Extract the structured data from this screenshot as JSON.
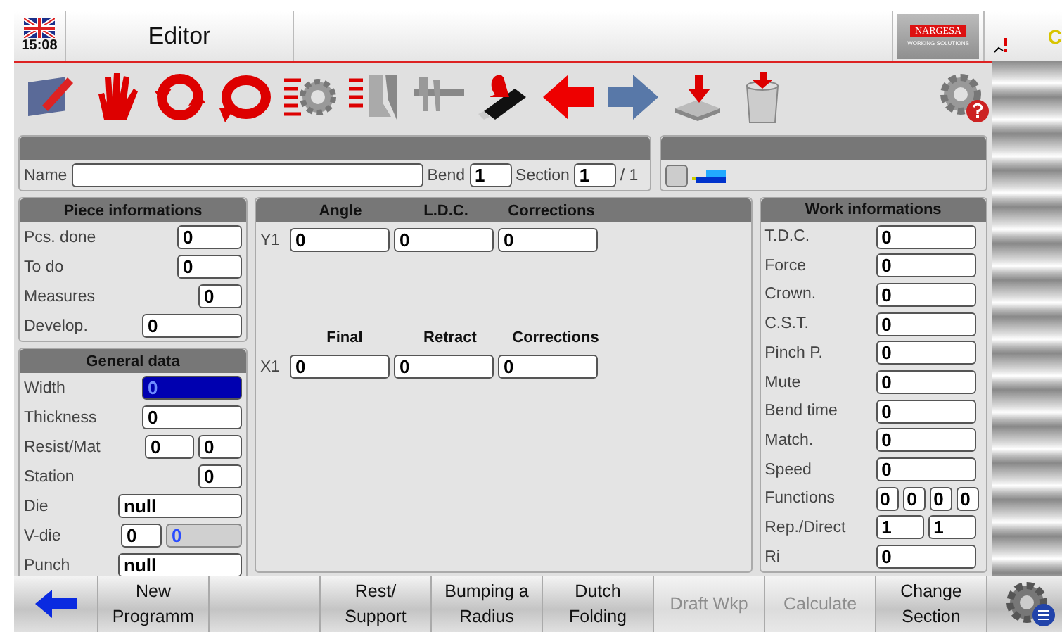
{
  "header": {
    "time": "15:08",
    "title": "Editor",
    "logo_brand": "NARGESA",
    "logo_tagline": "WORKING SOLUTIONS",
    "edge_text": "C"
  },
  "name_row": {
    "name_label": "Name",
    "bend_label": "Bend",
    "bend_value": "1",
    "section_label": "Section",
    "section_value": "1",
    "section_total": "/ 1"
  },
  "status_panel": {
    "checked": false
  },
  "piece_informations": {
    "title": "Piece informations",
    "rows": [
      {
        "label": "Pcs. done",
        "kind": "short",
        "values": [
          "0"
        ]
      },
      {
        "label": "To do",
        "kind": "short",
        "values": [
          "0"
        ]
      },
      {
        "label": "Measures",
        "kind": "tiny",
        "values": [
          "0"
        ]
      },
      {
        "label": "Develop.",
        "kind": "long",
        "values": [
          "0"
        ]
      }
    ]
  },
  "general_data": {
    "title": "General data",
    "rows": [
      {
        "label": "Width",
        "kind": "long",
        "fields": [
          {
            "value": "0",
            "selected": true,
            "disabled": false
          }
        ]
      },
      {
        "label": "Thickness",
        "kind": "long",
        "fields": [
          {
            "value": "0",
            "selected": false,
            "disabled": false
          }
        ]
      },
      {
        "label": "Resist/Mat",
        "kind": "pair",
        "fields": [
          {
            "value": "0",
            "selected": false,
            "disabled": false
          },
          {
            "value": "0",
            "selected": false,
            "disabled": false
          }
        ]
      },
      {
        "label": "Station",
        "kind": "tiny",
        "fields": [
          {
            "value": "0",
            "selected": false,
            "disabled": false
          }
        ]
      },
      {
        "label": "Die",
        "kind": "wide",
        "fields": [
          {
            "value": "null",
            "selected": false,
            "disabled": false
          }
        ]
      },
      {
        "label": "V-die",
        "kind": "split",
        "fields": [
          {
            "value": "0",
            "selected": false,
            "disabled": false
          },
          {
            "value": "0",
            "selected": false,
            "disabled": true
          }
        ]
      },
      {
        "label": "Punch",
        "kind": "wide",
        "fields": [
          {
            "value": "null",
            "selected": false,
            "disabled": false
          }
        ]
      }
    ]
  },
  "axes": [
    {
      "columns": [
        "Angle",
        "L.D.C.",
        "Corrections"
      ],
      "label": "Y1",
      "values": [
        "0",
        "0",
        "0"
      ]
    },
    {
      "columns": [
        "Final",
        "Retract",
        "Corrections"
      ],
      "label": "X1",
      "values": [
        "0",
        "0",
        "0"
      ]
    }
  ],
  "work_informations": {
    "title": "Work informations",
    "rows": [
      {
        "label": "T.D.C.",
        "values": [
          "0"
        ]
      },
      {
        "label": "Force",
        "values": [
          "0"
        ]
      },
      {
        "label": "Crown.",
        "values": [
          "0"
        ]
      },
      {
        "label": "C.S.T.",
        "values": [
          "0"
        ]
      },
      {
        "label": "Pinch P.",
        "values": [
          "0"
        ]
      },
      {
        "label": "Mute",
        "values": [
          "0"
        ]
      },
      {
        "label": "Bend time",
        "values": [
          "0"
        ]
      },
      {
        "label": "Match.",
        "values": [
          "0"
        ]
      },
      {
        "label": "Speed",
        "values": [
          "0"
        ]
      },
      {
        "label": "Functions",
        "values": [
          "0",
          "0",
          "0",
          "0"
        ]
      },
      {
        "label": "Rep./Direct",
        "values": [
          "1",
          "1"
        ]
      },
      {
        "label": "Ri",
        "values": [
          "0"
        ]
      }
    ]
  },
  "bottom_buttons": [
    {
      "kind": "back"
    },
    {
      "kind": "text",
      "lines": [
        "New",
        "Programm"
      ],
      "disabled": false
    },
    {
      "kind": "blank"
    },
    {
      "kind": "text",
      "lines": [
        "Rest/",
        "Support"
      ],
      "disabled": false
    },
    {
      "kind": "text",
      "lines": [
        "Bumping a",
        "Radius"
      ],
      "disabled": false
    },
    {
      "kind": "text",
      "lines": [
        "Dutch",
        "Folding"
      ],
      "disabled": false
    },
    {
      "kind": "text",
      "lines": [
        "Draft Wkp"
      ],
      "disabled": true
    },
    {
      "kind": "text",
      "lines": [
        "Calculate"
      ],
      "disabled": true
    },
    {
      "kind": "text",
      "lines": [
        "Change",
        "Section"
      ],
      "disabled": false
    }
  ]
}
